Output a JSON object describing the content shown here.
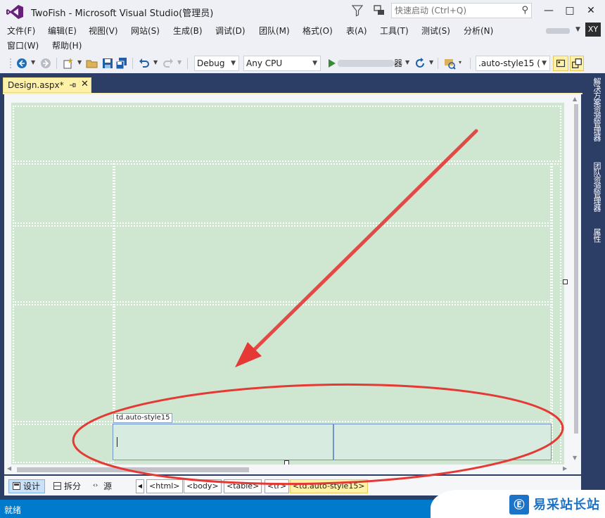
{
  "window": {
    "title": "TwoFish - Microsoft Visual Studio(管理员)",
    "quick_launch_placeholder": "快速启动 (Ctrl+Q)",
    "minimize": "—",
    "restore": "□",
    "close": "✕",
    "user_initials": "XY"
  },
  "menu": {
    "row1": [
      "文件(F)",
      "编辑(E)",
      "视图(V)",
      "网站(S)",
      "生成(B)",
      "调试(D)",
      "团队(M)",
      "格式(O)",
      "表(A)",
      "工具(T)",
      "测试(S)",
      "分析(N)"
    ],
    "row2": [
      "窗口(W)",
      "帮助(H)"
    ]
  },
  "toolbar": {
    "configuration": "Debug",
    "platform": "Any CPU",
    "run_suffix": "器",
    "style_target": ".auto-style15 (\u0000"
  },
  "document_tab": {
    "label": "Design.aspx*",
    "close": "✕"
  },
  "designer": {
    "selected_cell_tag": "td.auto-style15"
  },
  "view_buttons": {
    "design": "设计",
    "split": "拆分",
    "source": "源"
  },
  "breadcrumbs": [
    "<html>",
    "<body>",
    "<table>",
    "<tr>",
    "<td.auto-style15>"
  ],
  "side_panels": [
    "解决方案资源管理器",
    "团队资源管理器",
    "属性"
  ],
  "status": {
    "text": "就绪"
  },
  "watermark": {
    "text": "易采站长站",
    "logo_glyph": "Ⓔ"
  },
  "colors": {
    "accent": "#007acc",
    "frame": "#2d3e66",
    "tab_active": "#fff1a8",
    "page_bg": "#cfe6d1",
    "annotation": "#e53935"
  }
}
